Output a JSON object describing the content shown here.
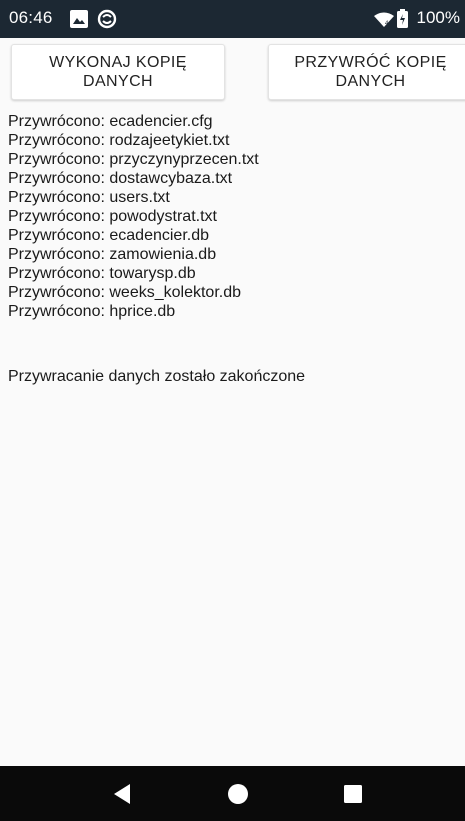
{
  "status_bar": {
    "time": "06:46",
    "battery": "100%",
    "icons": [
      "image-icon",
      "sync-icon",
      "wifi-icon",
      "battery-icon"
    ]
  },
  "buttons": {
    "backup_label": "WYKONAJ KOPIĘ DANYCH",
    "restore_label": "PRZYWRÓĆ KOPIĘ DANYCH"
  },
  "log": {
    "lines": [
      "Przywrócono: ecadencier.cfg",
      "Przywrócono: rodzajeetykiet.txt",
      "Przywrócono: przyczynyprzecen.txt",
      "Przywrócono: dostawcybaza.txt",
      "Przywrócono: users.txt",
      "Przywrócono: powodystrat.txt",
      "Przywrócono: ecadencier.db",
      "Przywrócono: zamowienia.db",
      "Przywrócono: towarysp.db",
      "Przywrócono: weeks_kolektor.db",
      "Przywrócono: hprice.db"
    ],
    "summary": "Przywracanie danych zostało zakończone"
  },
  "nav_bar": {
    "icons": [
      "back-icon",
      "home-icon",
      "recents-icon"
    ]
  },
  "colors": {
    "status_bar_bg": "#1c2833",
    "nav_bar_bg": "#0a0a0a",
    "background": "#fafafa"
  }
}
